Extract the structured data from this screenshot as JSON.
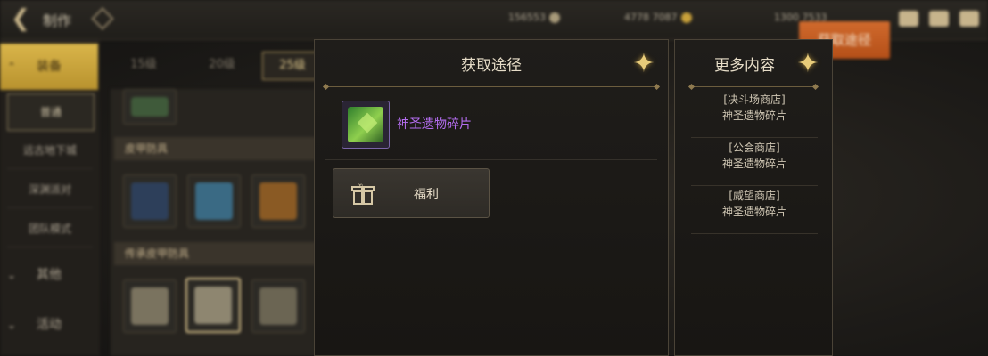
{
  "topbar": {
    "title": "制作",
    "currencies": [
      "156553",
      "4778 7087",
      "1300 7533"
    ],
    "acquire_button": "获取途径"
  },
  "leftnav": {
    "category_active": "装备",
    "sub_items": [
      "普通",
      "远古地下城",
      "深渊派对",
      "团队模式"
    ],
    "other_categories": [
      "其他",
      "活动"
    ]
  },
  "level_tabs": [
    "15级",
    "20级",
    "25级"
  ],
  "item_sections": [
    "皮甲防具",
    "传承皮甲防具"
  ],
  "dialog": {
    "title": "获取途径",
    "item_name": "神圣遗物碎片",
    "welfare_label": "福利",
    "item_name_color": "#b46df0",
    "close_icon": "close-star-icon"
  },
  "side_panel": {
    "title": "更多内容",
    "items": [
      {
        "line1": "[决斗场商店]",
        "line2": "神圣遗物碎片"
      },
      {
        "line1": "[公会商店]",
        "line2": "神圣遗物碎片"
      },
      {
        "line1": "[威望商店]",
        "line2": "神圣遗物碎片"
      }
    ]
  },
  "colors": {
    "accent_gold": "#d9b54a",
    "acquire_orange": "#d06a2d",
    "rarity_purple": "#b46df0"
  }
}
